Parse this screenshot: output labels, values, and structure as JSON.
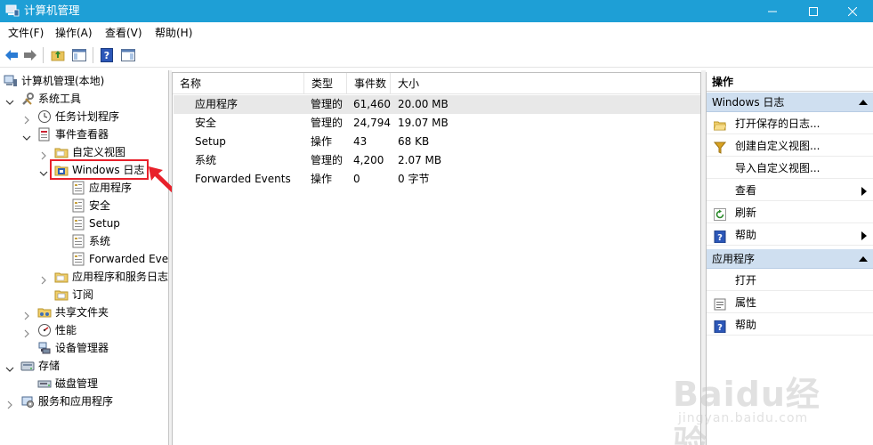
{
  "window": {
    "title": "计算机管理"
  },
  "menu": [
    "文件(F)",
    "操作(A)",
    "查看(V)",
    "帮助(H)"
  ],
  "tree": [
    {
      "label": "计算机管理(本地)",
      "icon": "computer-icon",
      "expander": "none"
    },
    {
      "label": "系统工具",
      "icon": "tools-icon",
      "expander": "expanded"
    },
    {
      "label": "任务计划程序",
      "icon": "clock-icon",
      "expander": "collapsed"
    },
    {
      "label": "事件查看器",
      "icon": "event-viewer-icon",
      "expander": "expanded"
    },
    {
      "label": "自定义视图",
      "icon": "folder-icon",
      "expander": "collapsed"
    },
    {
      "label": "Windows 日志",
      "icon": "windows-log-icon",
      "expander": "expanded"
    },
    {
      "label": "应用程序",
      "icon": "log-icon",
      "expander": "none"
    },
    {
      "label": "安全",
      "icon": "log-icon",
      "expander": "none"
    },
    {
      "label": "Setup",
      "icon": "log-icon",
      "expander": "none"
    },
    {
      "label": "系统",
      "icon": "log-icon",
      "expander": "none"
    },
    {
      "label": "Forwarded Eve",
      "icon": "log-icon",
      "expander": "none"
    },
    {
      "label": "应用程序和服务日志",
      "icon": "folder-icon",
      "expander": "collapsed"
    },
    {
      "label": "订阅",
      "icon": "subscription-icon",
      "expander": "none"
    },
    {
      "label": "共享文件夹",
      "icon": "shared-folder-icon",
      "expander": "collapsed"
    },
    {
      "label": "性能",
      "icon": "performance-icon",
      "expander": "collapsed"
    },
    {
      "label": "设备管理器",
      "icon": "device-manager-icon",
      "expander": "none"
    },
    {
      "label": "存储",
      "icon": "storage-icon",
      "expander": "expanded"
    },
    {
      "label": "磁盘管理",
      "icon": "disk-icon",
      "expander": "none"
    },
    {
      "label": "服务和应用程序",
      "icon": "services-icon",
      "expander": "collapsed"
    }
  ],
  "table": {
    "columns": [
      "名称",
      "类型",
      "事件数",
      "大小"
    ],
    "rows": [
      [
        "应用程序",
        "管理的",
        "61,460",
        "20.00 MB"
      ],
      [
        "安全",
        "管理的",
        "24,794",
        "19.07 MB"
      ],
      [
        "Setup",
        "操作",
        "43",
        "68 KB"
      ],
      [
        "系统",
        "管理的",
        "4,200",
        "2.07 MB"
      ],
      [
        "Forwarded Events",
        "操作",
        "0",
        "0 字节"
      ]
    ]
  },
  "actions": {
    "title": "操作",
    "group1": {
      "title": "Windows 日志",
      "items": [
        {
          "label": "打开保存的日志...",
          "icon": "open-folder-icon",
          "submenu": false
        },
        {
          "label": "创建自定义视图...",
          "icon": "filter-icon",
          "submenu": false
        },
        {
          "label": "导入自定义视图...",
          "icon": "none",
          "submenu": false
        },
        {
          "label": "查看",
          "icon": "none",
          "submenu": true
        },
        {
          "label": "刷新",
          "icon": "refresh-icon",
          "submenu": false
        },
        {
          "label": "帮助",
          "icon": "help-icon",
          "submenu": true
        }
      ]
    },
    "group2": {
      "title": "应用程序",
      "items": [
        {
          "label": "打开",
          "icon": "none",
          "submenu": false
        },
        {
          "label": "属性",
          "icon": "properties-icon",
          "submenu": false
        },
        {
          "label": "帮助",
          "icon": "help-icon",
          "submenu": false
        }
      ]
    }
  },
  "watermark": {
    "brand": "Baidu经验",
    "url": "jingyan.baidu.com"
  }
}
